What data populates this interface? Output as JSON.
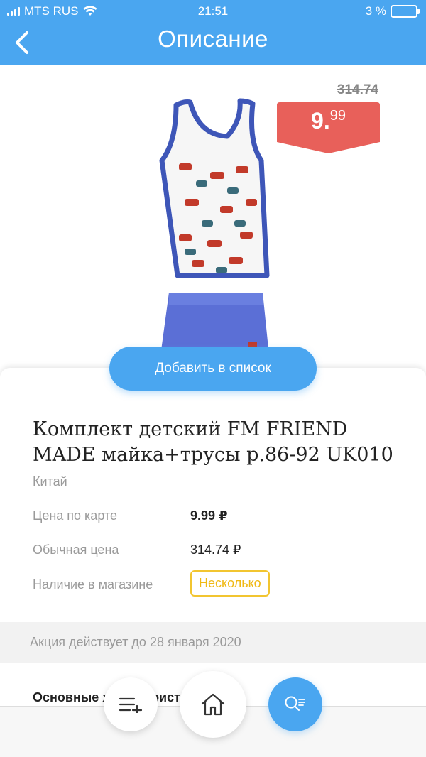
{
  "status": {
    "carrier": "MTS RUS",
    "time": "21:51",
    "battery": "3 %"
  },
  "nav": {
    "title": "Описание"
  },
  "price": {
    "old": "314.74",
    "current_int": "9.",
    "current_dec": "99"
  },
  "actions": {
    "add_to_list": "Добавить в список"
  },
  "product": {
    "title": "Комплект детский FM FRIEND MADE майка+трусы р.86-92 UK010",
    "country": "Китай",
    "rows": [
      {
        "label": "Цена по карте",
        "value": "9.99 ₽"
      },
      {
        "label": "Обычная цена",
        "value": "314.74 ₽"
      },
      {
        "label": "Наличие в магазине",
        "value": "Несколько"
      }
    ]
  },
  "promo": {
    "text": "Акция действует до 28 января 2020"
  },
  "section": {
    "title": "Основные характеристики"
  },
  "colors": {
    "accent": "#4aa6f0",
    "tag": "#e8605a",
    "stock": "#f2c530"
  },
  "icons": {
    "back": "chevron-left-icon",
    "list": "add-to-list-icon",
    "home": "home-icon",
    "search": "search-list-icon"
  }
}
